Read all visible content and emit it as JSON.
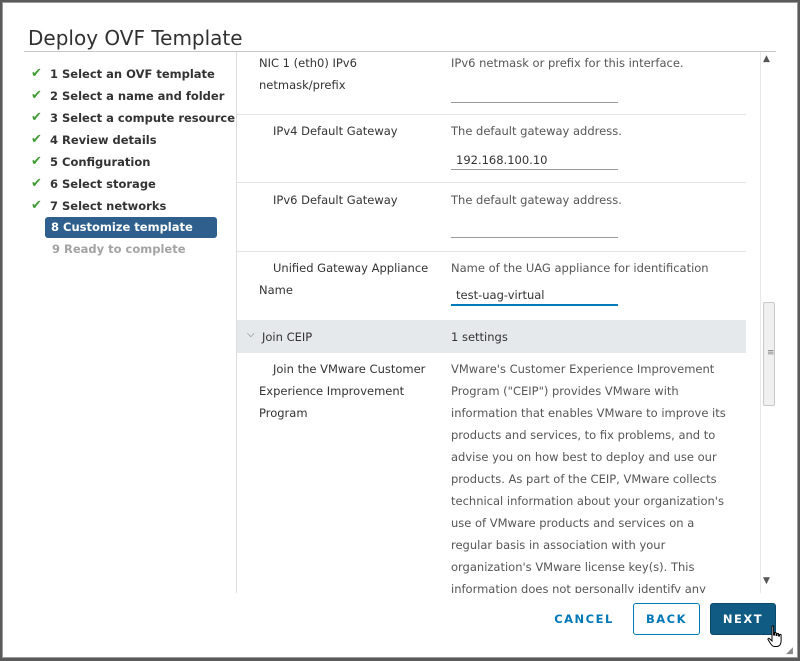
{
  "dialog": {
    "title": "Deploy OVF Template"
  },
  "steps": [
    {
      "label": "1 Select an OVF template",
      "state": "complete"
    },
    {
      "label": "2 Select a name and folder",
      "state": "complete"
    },
    {
      "label": "3 Select a compute resource",
      "state": "complete"
    },
    {
      "label": "4 Review details",
      "state": "complete"
    },
    {
      "label": "5 Configuration",
      "state": "complete"
    },
    {
      "label": "6 Select storage",
      "state": "complete"
    },
    {
      "label": "7 Select networks",
      "state": "complete"
    },
    {
      "label": "8 Customize template",
      "state": "active"
    },
    {
      "label": "9 Ready to complete",
      "state": "disabled"
    }
  ],
  "properties": [
    {
      "label_line1": "NIC 1 (eth0) IPv6",
      "label_line2": "netmask/prefix",
      "description": "IPv6 netmask or prefix for this interface.",
      "value": ""
    },
    {
      "label_line1": "IPv4 Default Gateway",
      "description": "The default gateway address.",
      "value": "192.168.100.10"
    },
    {
      "label_line1": "IPv6 Default Gateway",
      "description": "The default gateway address.",
      "value": ""
    },
    {
      "label_line1": "Unified Gateway Appliance",
      "label_line2": "Name",
      "description": "Name of the UAG appliance for identification",
      "value": "test-uag-virtual"
    }
  ],
  "group": {
    "name": "Join CEIP",
    "count": "1 settings"
  },
  "ceip": {
    "label_lines": [
      "Join the VMware Customer",
      "Experience Improvement",
      "Program"
    ],
    "description_lines": [
      "VMware's Customer Experience Improvement",
      "Program (\"CEIP\") provides VMware with",
      "information that enables VMware to improve its",
      "products and services, to fix problems, and to",
      "advise you on how best to deploy and use our",
      "products. As part of the CEIP, VMware collects",
      "technical information about your organization's",
      "use of VMware products and services on a",
      "regular basis in association with your",
      "organization's VMware license key(s). This",
      "information does not personally identify any"
    ]
  },
  "buttons": {
    "cancel": "CANCEL",
    "back": "BACK",
    "next": "NEXT"
  },
  "icons": {
    "check": "check-icon",
    "chevron": "chevron-down-icon",
    "cursor": "hand-cursor-icon"
  },
  "colors": {
    "active_step": "#2f5f8c",
    "check": "#3f9c35",
    "primary": "#0079b8",
    "next_button": "#0f5b83",
    "group_row": "#e6e9ec"
  }
}
